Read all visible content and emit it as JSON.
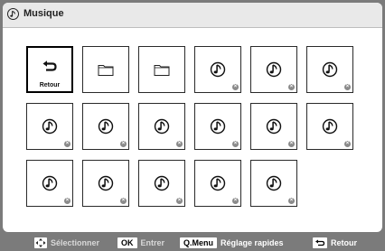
{
  "header": {
    "title": "Musique",
    "icon": "music-note-icon"
  },
  "grid": {
    "items": [
      {
        "type": "back",
        "label": "Retour",
        "icon": "return-arrow-icon",
        "selected": true
      },
      {
        "type": "folder",
        "icon": "folder-icon"
      },
      {
        "type": "folder",
        "icon": "folder-icon"
      },
      {
        "type": "music",
        "icon": "music-note-icon"
      },
      {
        "type": "music",
        "icon": "music-note-icon"
      },
      {
        "type": "music",
        "icon": "music-note-icon"
      },
      {
        "type": "music",
        "icon": "music-note-icon"
      },
      {
        "type": "music",
        "icon": "music-note-icon"
      },
      {
        "type": "music",
        "icon": "music-note-icon"
      },
      {
        "type": "music",
        "icon": "music-note-icon"
      },
      {
        "type": "music",
        "icon": "music-note-icon"
      },
      {
        "type": "music",
        "icon": "music-note-icon"
      },
      {
        "type": "music",
        "icon": "music-note-icon"
      },
      {
        "type": "music",
        "icon": "music-note-icon"
      },
      {
        "type": "music",
        "icon": "music-note-icon"
      },
      {
        "type": "music",
        "icon": "music-note-icon"
      },
      {
        "type": "music",
        "icon": "music-note-icon"
      }
    ]
  },
  "footer": {
    "select": {
      "icon": "dpad-icon",
      "label": "Sélectionner"
    },
    "enter": {
      "key": "OK",
      "label": "Entrer"
    },
    "qmenu": {
      "key": "Q.Menu",
      "label": "Réglage rapides"
    },
    "back": {
      "icon": "return-arrow-icon",
      "label": "Retour"
    }
  },
  "colors": {
    "background": "#7b7b7b",
    "panel": "#ffffff",
    "header": "#e9e9e9",
    "badge": "#8a8a8a"
  }
}
